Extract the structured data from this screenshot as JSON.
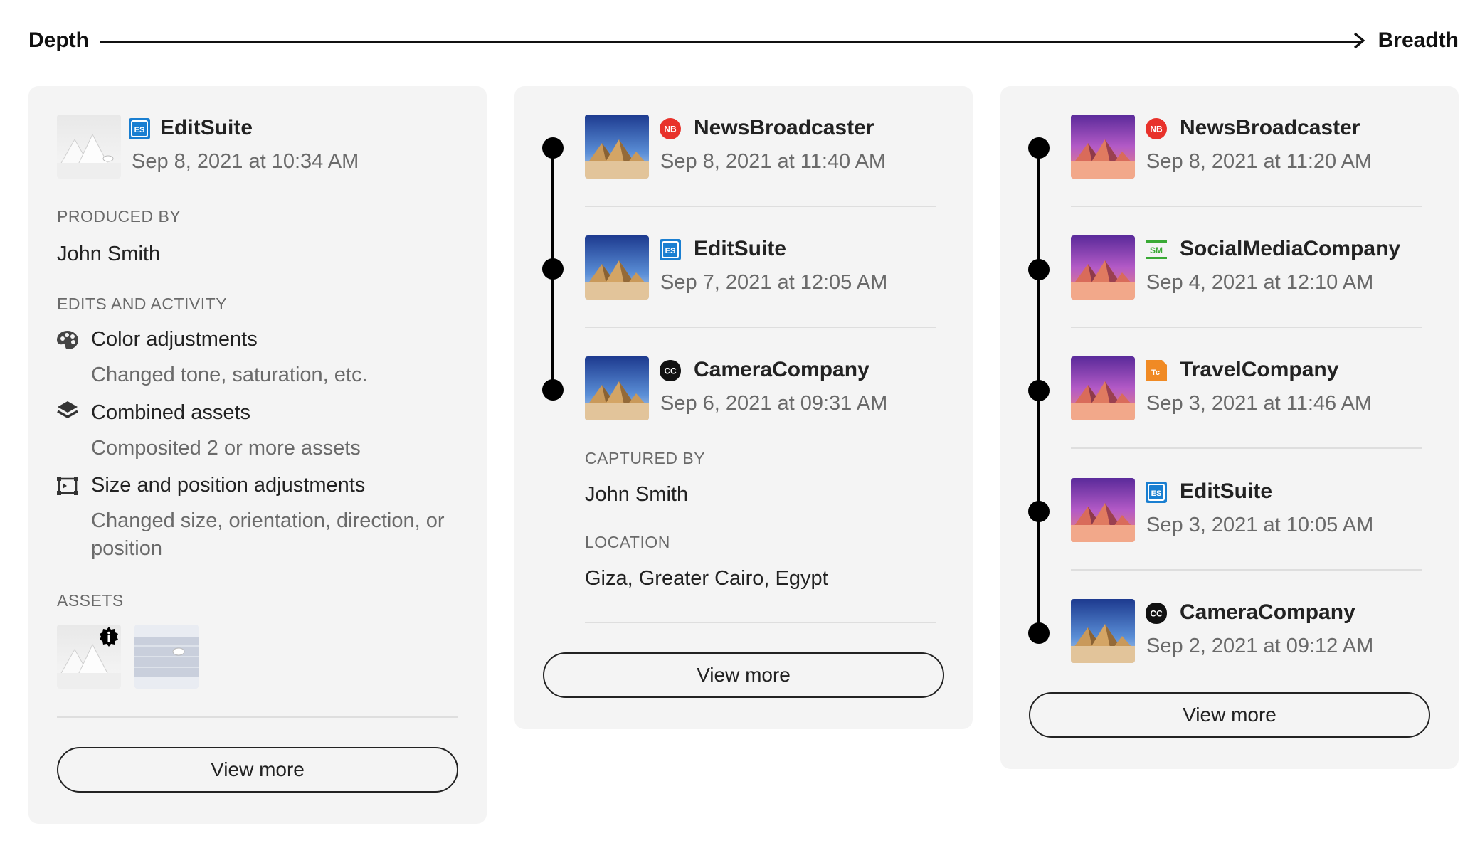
{
  "axis": {
    "left_label": "Depth",
    "right_label": "Breadth"
  },
  "card1": {
    "header": {
      "brand": "EditSuite",
      "date": "Sep 8, 2021 at 10:34 AM",
      "logo_text": "ES"
    },
    "produced_by_label": "PRODUCED BY",
    "produced_by_value": "John Smith",
    "edits_label": "EDITS AND ACTIVITY",
    "edits": [
      {
        "title": "Color adjustments",
        "desc": "Changed tone, saturation, etc.",
        "icon": "palette-icon"
      },
      {
        "title": "Combined assets",
        "desc": "Composited 2 or more assets",
        "icon": "layers-icon"
      },
      {
        "title": "Size and position adjustments",
        "desc": "Changed size, orientation, direction, or position",
        "icon": "crop-icon"
      }
    ],
    "assets_label": "ASSETS",
    "view_more": "View more"
  },
  "card2": {
    "items": [
      {
        "brand": "NewsBroadcaster",
        "date": "Sep 8, 2021 at 11:40 AM",
        "logo_text": "NB"
      },
      {
        "brand": "EditSuite",
        "date": "Sep 7, 2021 at 12:05 AM",
        "logo_text": "ES"
      },
      {
        "brand": "CameraCompany",
        "date": "Sep 6, 2021 at 09:31 AM",
        "logo_text": "CC"
      }
    ],
    "captured_by_label": "CAPTURED BY",
    "captured_by_value": "John Smith",
    "location_label": "LOCATION",
    "location_value": "Giza, Greater Cairo, Egypt",
    "view_more": "View more"
  },
  "card3": {
    "items": [
      {
        "brand": "NewsBroadcaster",
        "date": "Sep 8, 2021 at 11:20 AM",
        "logo_text": "NB"
      },
      {
        "brand": "SocialMediaCompany",
        "date": "Sep 4, 2021 at 12:10 AM",
        "logo_text": "SM"
      },
      {
        "brand": "TravelCompany",
        "date": "Sep 3, 2021 at 11:46 AM",
        "logo_text": "Tc"
      },
      {
        "brand": "EditSuite",
        "date": "Sep 3, 2021 at 10:05 AM",
        "logo_text": "ES"
      },
      {
        "brand": "CameraCompany",
        "date": "Sep 2, 2021 at 09:12 AM",
        "logo_text": "CC"
      }
    ],
    "view_more": "View more"
  },
  "colors": {
    "nb_red": "#e8322b",
    "es_blue": "#1a7fd1",
    "sm_green": "#3aaa35",
    "tc_orange": "#f08a24",
    "cc_black": "#111111",
    "card_bg": "#f4f4f4"
  }
}
